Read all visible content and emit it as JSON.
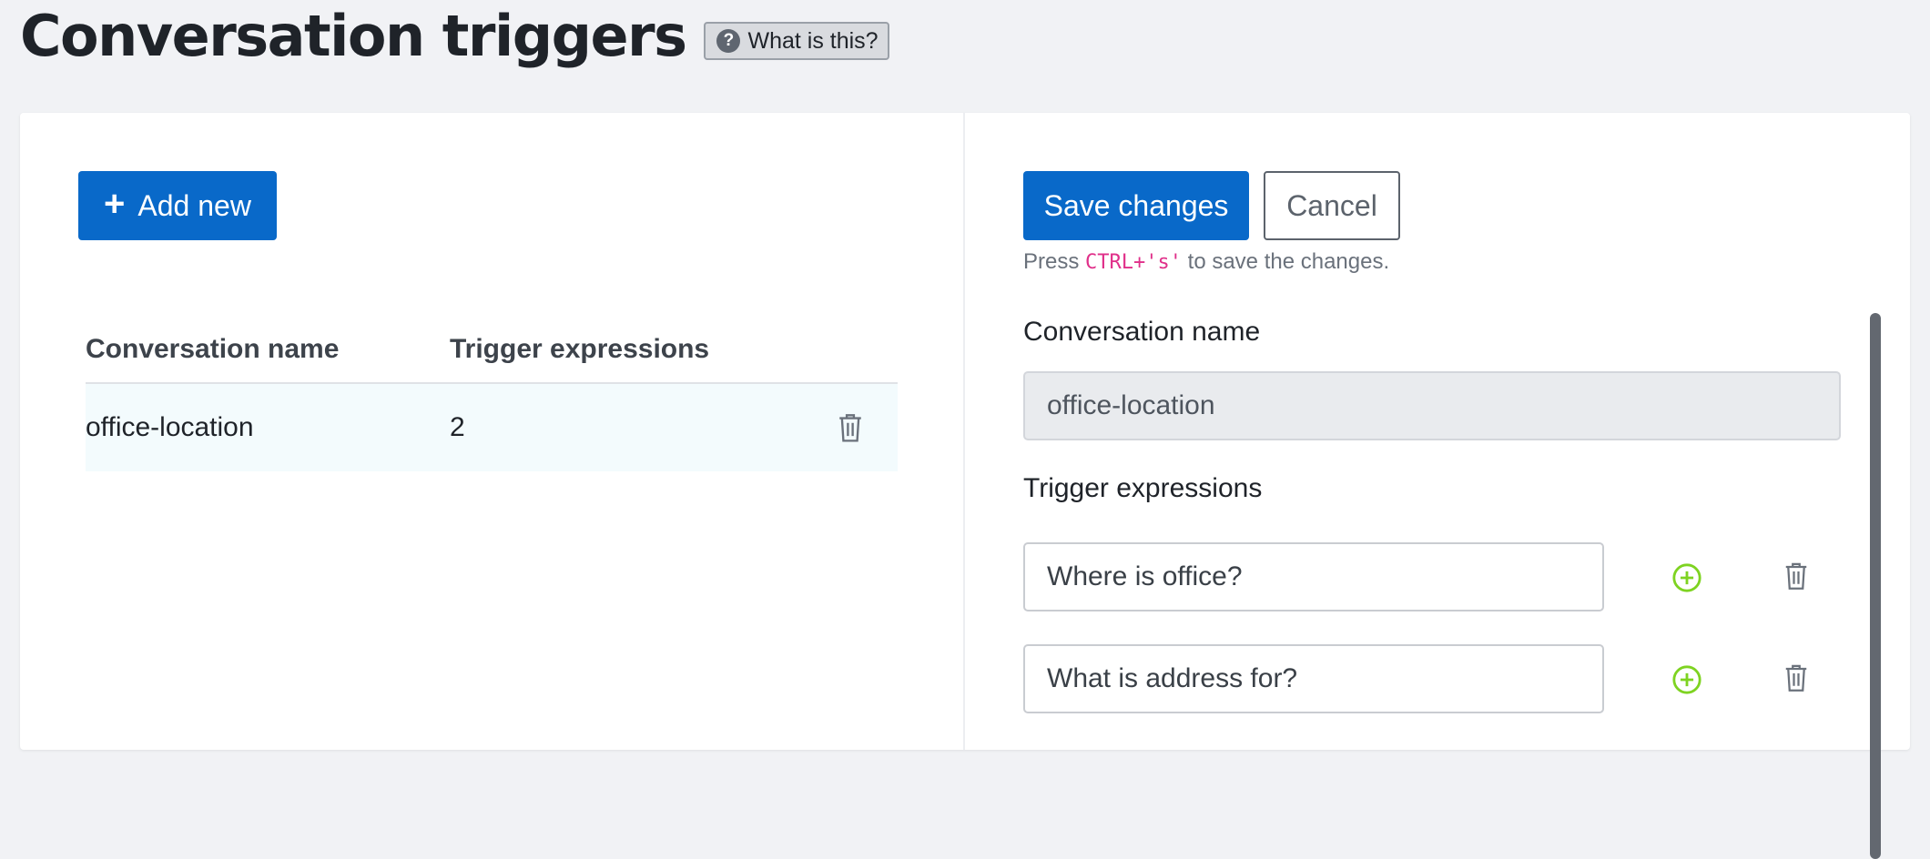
{
  "header": {
    "title": "Conversation triggers",
    "help_label": "What is this?",
    "help_icon": "question-circle-icon"
  },
  "list_panel": {
    "add_new_label": "Add new",
    "columns": [
      "Conversation name",
      "Trigger expressions"
    ],
    "rows": [
      {
        "name": "office-location",
        "count": "2"
      }
    ]
  },
  "editor": {
    "save_label": "Save changes",
    "cancel_label": "Cancel",
    "hint_prefix": "Press ",
    "hint_shortcut": "CTRL+'s'",
    "hint_suffix": " to save the changes.",
    "name_label": "Conversation name",
    "name_value": "office-location",
    "expressions_label": "Trigger expressions",
    "expressions": [
      {
        "value": "Where is office?"
      },
      {
        "value": "What is address for?"
      }
    ]
  },
  "colors": {
    "primary": "#0969c9",
    "add_icon": "#7ed321",
    "shortcut": "#e0308a",
    "selected_row": "#f3fbfd"
  }
}
